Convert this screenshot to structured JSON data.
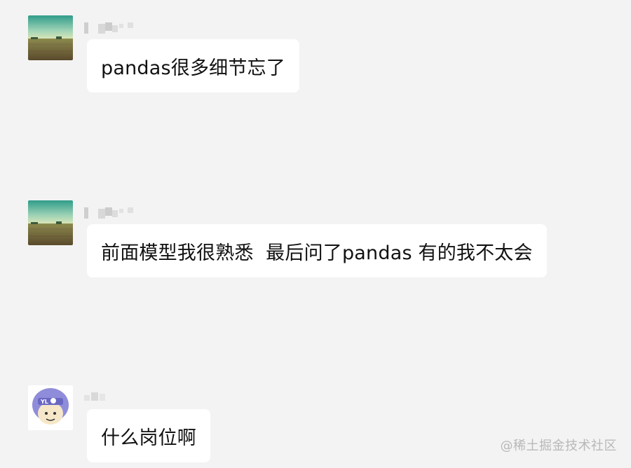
{
  "messages": [
    {
      "sender": "contact-1",
      "avatar_icon": "landscape-field-avatar",
      "text": "pandas很多细节忘了"
    },
    {
      "sender": "contact-1",
      "avatar_icon": "landscape-field-avatar",
      "text": "前面模型我很熟悉  最后问了pandas 有的我不太会"
    },
    {
      "sender": "contact-2",
      "avatar_icon": "cartoon-helmet-avatar",
      "text": "什么岗位啊"
    }
  ],
  "watermark": "@稀土掘金技术社区"
}
